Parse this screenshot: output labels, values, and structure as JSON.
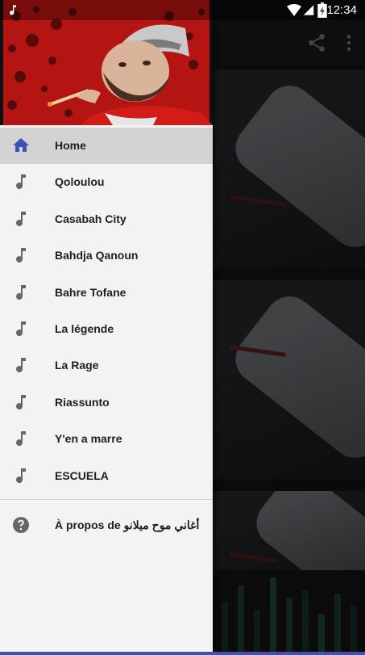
{
  "status_bar": {
    "time": "12:34",
    "icons": [
      "music-note-icon",
      "wifi-icon",
      "signal-icon",
      "battery-charging-icon"
    ]
  },
  "toolbar": {
    "icons": [
      "share-icon",
      "more-vert-icon"
    ]
  },
  "drawer": {
    "menu_items": [
      {
        "label": "Home",
        "icon": "home-icon",
        "active": true
      },
      {
        "label": "Qoloulou",
        "icon": "music-note-icon"
      },
      {
        "label": "Casabah City",
        "icon": "music-note-icon"
      },
      {
        "label": "Bahdja Qanoun",
        "icon": "music-note-icon"
      },
      {
        "label": "Bahre Tofane",
        "icon": "music-note-icon"
      },
      {
        "label": "La légende",
        "icon": "music-note-icon"
      },
      {
        "label": "La Rage",
        "icon": "music-note-icon"
      },
      {
        "label": "Riassunto",
        "icon": "music-note-icon"
      },
      {
        "label": "Y'en a marre",
        "icon": "music-note-icon"
      },
      {
        "label": "ESCUELA",
        "icon": "music-note-icon"
      }
    ],
    "about": {
      "label": "À propos de أغاني موح ميلانو",
      "icon": "help-circle-icon"
    }
  },
  "colors": {
    "accent": "#3f51b5",
    "header_red": "#b51512",
    "drawer_bg": "#f3f3f3",
    "active_item_bg": "#d3d3d3"
  }
}
